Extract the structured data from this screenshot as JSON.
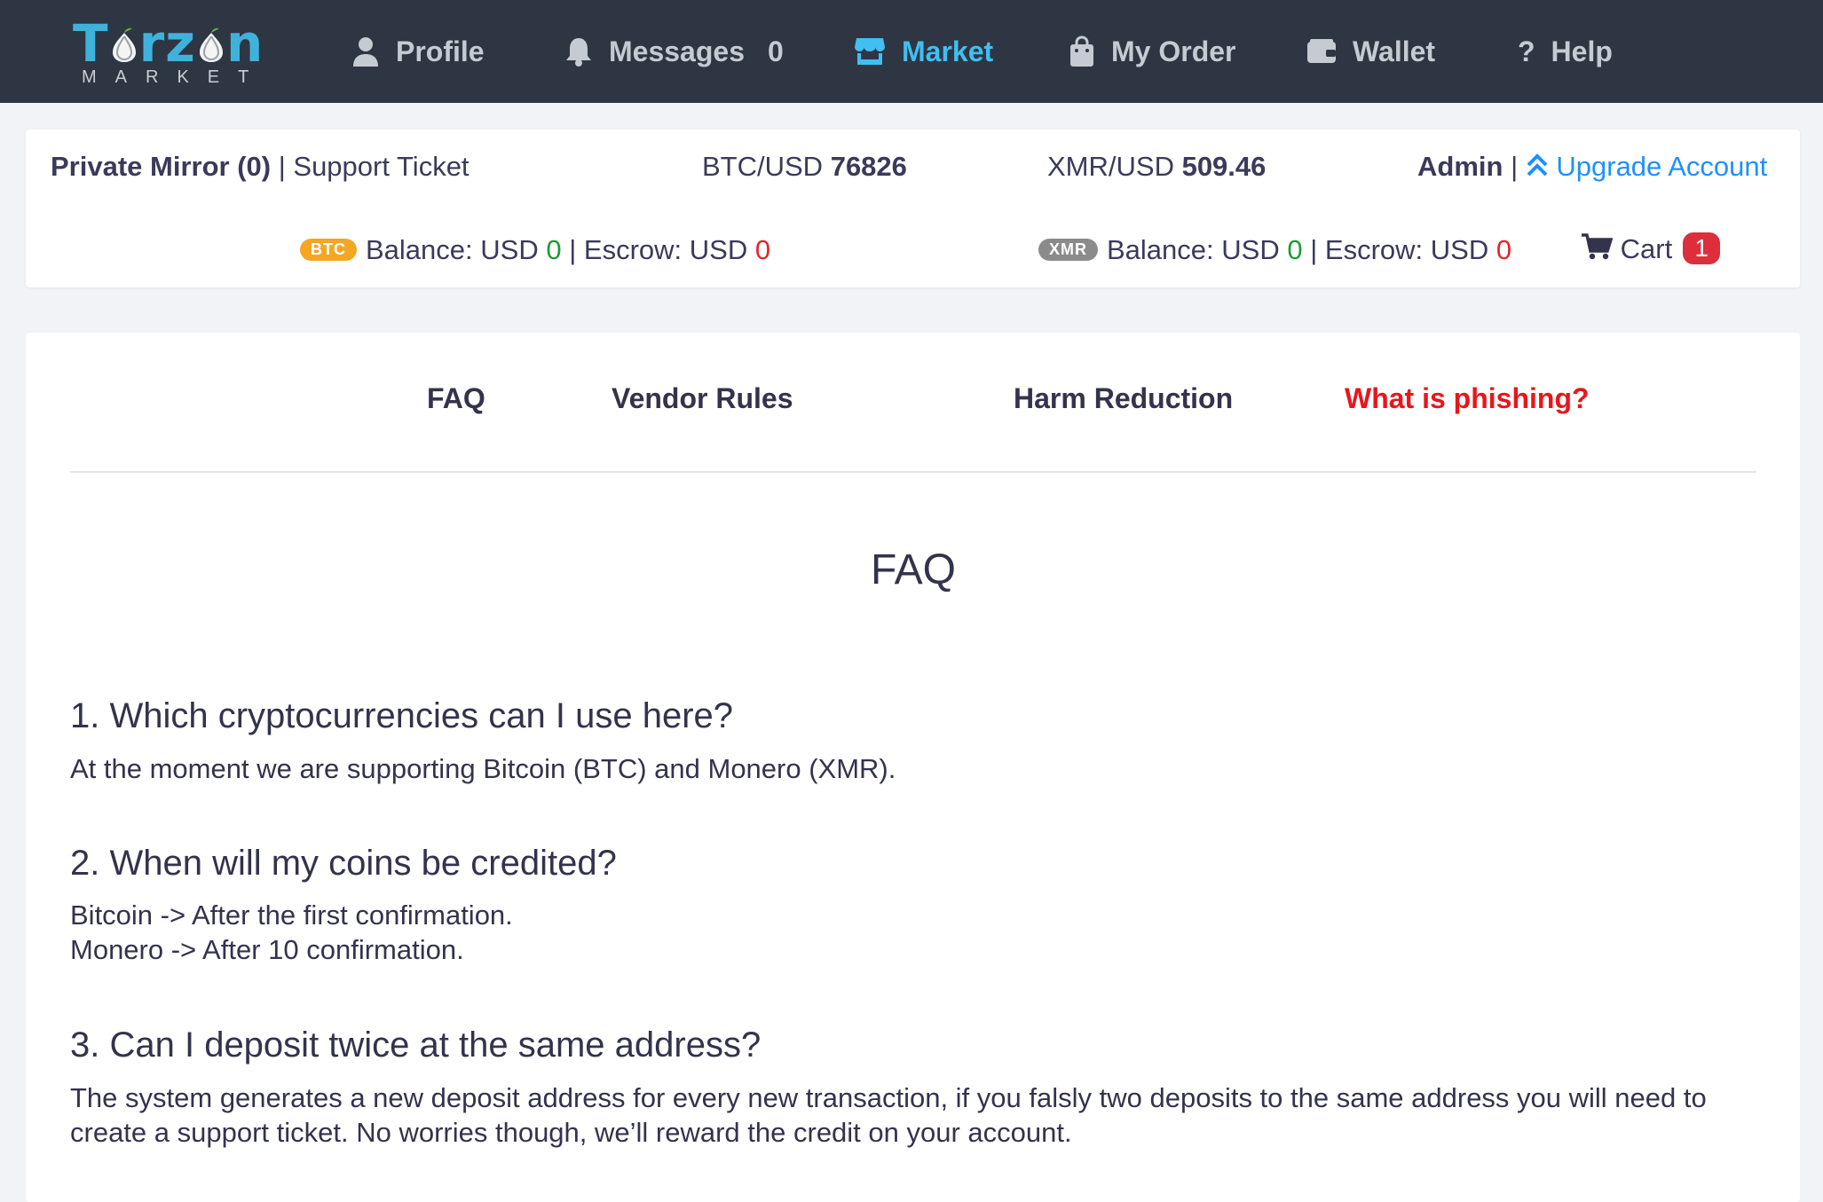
{
  "brand": {
    "name_part1": "T",
    "name_part2": "rz",
    "name_part3": "n",
    "sub": "MARKET"
  },
  "nav": {
    "profile": "Profile",
    "messages": "Messages",
    "messages_count": "0",
    "market": "Market",
    "my_order": "My Order",
    "wallet": "Wallet",
    "help": "Help"
  },
  "info": {
    "private_mirror": "Private Mirror (0)",
    "separator": "|",
    "support_ticket": "Support Ticket",
    "btc_usd_label": "BTC/USD",
    "btc_usd_value": "76826",
    "xmr_usd_label": "XMR/USD",
    "xmr_usd_value": "509.46",
    "admin": "Admin",
    "upgrade_account": "Upgrade Account",
    "btc_badge": "BTC",
    "xmr_badge": "XMR",
    "balance_label": "Balance: USD",
    "escrow_label": "Escrow: USD",
    "btc_balance": "0",
    "btc_escrow": "0",
    "xmr_balance": "0",
    "xmr_escrow": "0",
    "cart_label": "Cart",
    "cart_count": "1"
  },
  "tabs": {
    "faq": "FAQ",
    "vendor_rules": "Vendor Rules",
    "harm_reduction": "Harm Reduction",
    "phishing": "What is phishing?"
  },
  "faq": {
    "title": "FAQ",
    "q1": "1. Which cryptocurrencies can I use here?",
    "a1": "At the moment we are supporting Bitcoin (BTC) and Monero (XMR).",
    "q2": "2. When will my coins be credited?",
    "a2_line1": "Bitcoin -> After the first confirmation.",
    "a2_line2": "Monero -> After 10 confirmation.",
    "q3": "3. Can I deposit twice at the same address?",
    "a3": "The system generates a new deposit address for every new transaction, if you falsly two deposits to the same address you will need to create a support ticket. No worries though, we’ll reward the credit on your account."
  },
  "colors": {
    "navbar": "#2e3643",
    "accent": "#40bff0",
    "link": "#1e90ff",
    "danger": "#e3252c",
    "success": "#1f9a3a"
  }
}
